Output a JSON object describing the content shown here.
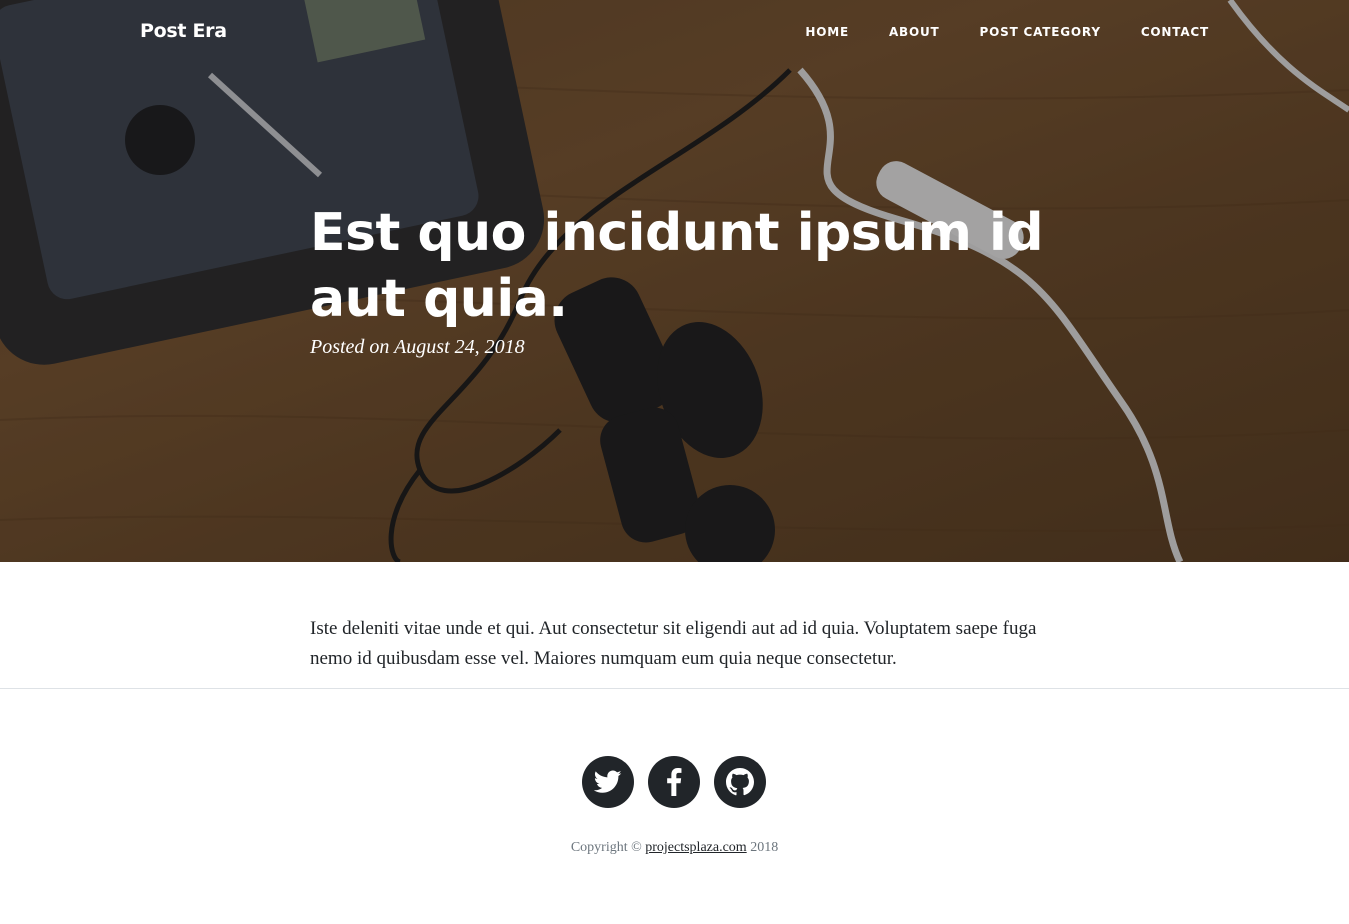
{
  "nav": {
    "brand": "Post Era",
    "items": [
      "HOME",
      "ABOUT",
      "POST CATEGORY",
      "CONTACT"
    ]
  },
  "header": {
    "title": "Est quo incidunt ipsum id aut quia.",
    "meta": "Posted on August 24, 2018"
  },
  "article": {
    "body": "Iste deleniti vitae unde et qui. Aut consectetur sit eligendi aut ad id quia. Voluptatem saepe fuga nemo id quibusdam esse vel. Maiores numquam eum quia neque consectetur."
  },
  "footer": {
    "social": [
      "twitter-icon",
      "facebook-icon",
      "github-icon"
    ],
    "copyright_prefix": "Copyright © ",
    "copyright_link": "projectsplaza.com",
    "copyright_suffix": " 2018"
  },
  "colors": {
    "footer_icon_bg": "#212529",
    "body_text": "#212529",
    "muted_text": "#6c757d",
    "divider": "#dee2e6"
  }
}
